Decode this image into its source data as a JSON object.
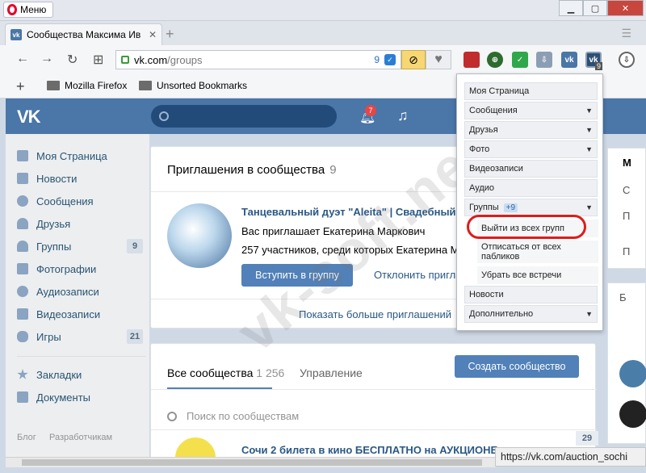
{
  "browser": {
    "menu_label": "Меню",
    "tab_title": "Сообщества Максима Ив",
    "url_host": "vk.com",
    "url_path": "/groups",
    "url_badge_count": "9",
    "shield_badge": "9",
    "ext_badge": "9",
    "bookmarks": [
      "Mozilla Firefox",
      "Unsorted Bookmarks"
    ],
    "status_url": "https://vk.com/auction_sochi"
  },
  "vk": {
    "notifications_count": "7",
    "left_menu": [
      {
        "label": "Моя Страница",
        "badge": ""
      },
      {
        "label": "Новости",
        "badge": ""
      },
      {
        "label": "Сообщения",
        "badge": ""
      },
      {
        "label": "Друзья",
        "badge": ""
      },
      {
        "label": "Группы",
        "badge": "9"
      },
      {
        "label": "Фотографии",
        "badge": ""
      },
      {
        "label": "Аудиозаписи",
        "badge": ""
      },
      {
        "label": "Видеозаписи",
        "badge": ""
      },
      {
        "label": "Игры",
        "badge": "21"
      },
      {
        "label": "Закладки",
        "badge": ""
      },
      {
        "label": "Документы",
        "badge": ""
      }
    ],
    "footer_links": [
      "Блог",
      "Разработчикам"
    ],
    "invitations": {
      "title": "Приглашения в сообщества",
      "count": "9",
      "group_name": "Танцевальный дуэт \"Aleita\" | Свадебный тан",
      "invited_by": "Вас приглашает Екатерина Маркович",
      "members": "257 участников, среди которых Екатерина М",
      "join_button": "Вступить в группу",
      "decline_link": "Отклонить пригла",
      "show_more": "Показать больше приглашений"
    },
    "communities": {
      "tab_all": "Все сообщества",
      "tab_all_count": "1 256",
      "tab_manage": "Управление",
      "create_button": "Создать сообщество",
      "search_placeholder": "Поиск по сообществам",
      "first_item": "Сочи 2 билета в кино БЕСПЛАТНО на АУКЦИОНЕ",
      "first_item_count": "29"
    },
    "right_letters": [
      "М",
      "С",
      "П",
      "П",
      "Б"
    ]
  },
  "dropdown": {
    "items": [
      {
        "label": "Моя Страница",
        "arrow": false
      },
      {
        "label": "Сообщения",
        "arrow": true
      },
      {
        "label": "Друзья",
        "arrow": true
      },
      {
        "label": "Фото",
        "arrow": true
      },
      {
        "label": "Видеозаписи",
        "arrow": false
      },
      {
        "label": "Аудио",
        "arrow": false
      },
      {
        "label": "Группы",
        "arrow": true,
        "plus": "+9"
      }
    ],
    "sub_items": [
      "Выйти из всех групп",
      "Отписаться от всех пабликов",
      "Убрать все встречи"
    ],
    "bottom_items": [
      {
        "label": "Новости",
        "arrow": false
      },
      {
        "label": "Дополнительно",
        "arrow": true
      }
    ]
  },
  "watermark": "vk-soft.net"
}
